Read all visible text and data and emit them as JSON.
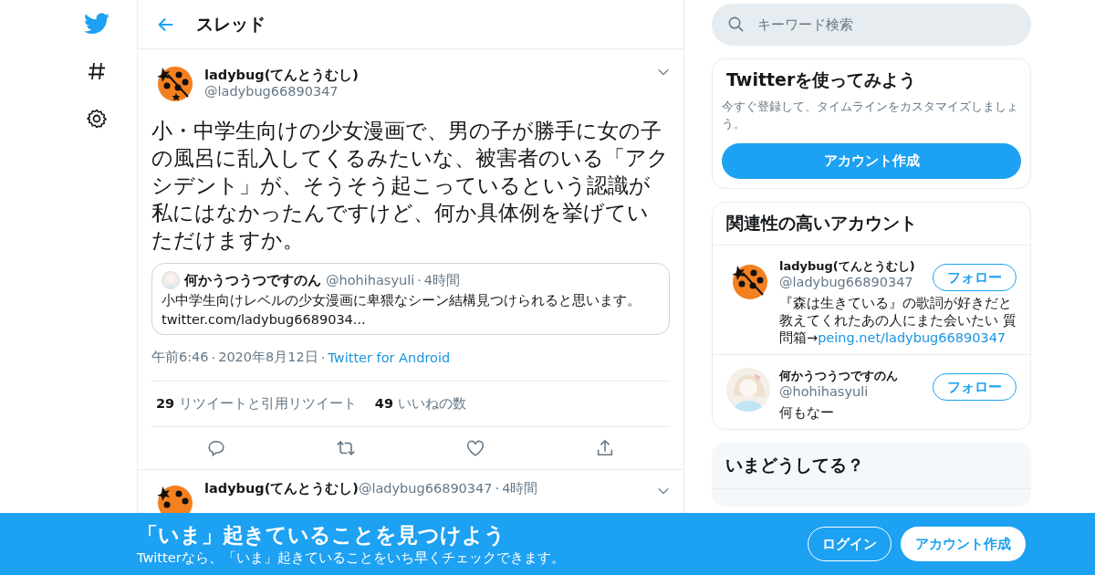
{
  "header": {
    "title": "スレッド"
  },
  "tweet": {
    "name": "ladybug(てんとうむし)",
    "handle": "@ladybug66890347",
    "text": "小・中学生向けの少女漫画で、男の子が勝手に女の子の風呂に乱入してくるみたいな、被害者のいる「アクシデント」が、そうそう起こっているという認識が私にはなかったんですけど、何か具体例を挙げていただけますか。",
    "quote": {
      "name": "何かうつうつですのん",
      "handle": "@hohihasyuli",
      "separator": "·",
      "time": "4時間",
      "text": "小中学生向けレベルの少女漫画に卑猥なシーン結構見つけられると思います。",
      "link": "twitter.com/ladybug6689034..."
    },
    "time": "午前6:46",
    "separators": [
      "·",
      "·"
    ],
    "date": "2020年8月12日",
    "source": "Twitter for Android",
    "stats": [
      {
        "count": "29",
        "label": "リツイートと引用リツイート"
      },
      {
        "count": "49",
        "label": "いいねの数"
      }
    ]
  },
  "reply": {
    "name": "ladybug(てんとうむし)",
    "handle": "@ladybug66890347",
    "separator": "·",
    "time": "4時間"
  },
  "search": {
    "placeholder": "キーワード検索"
  },
  "signup": {
    "title": "Twitterを使ってみよう",
    "text": "今すぐ登録して、タイムラインをカスタマイズしましょう。",
    "button": "アカウント作成"
  },
  "related": {
    "title": "関連性の高いアカウント",
    "accounts": [
      {
        "kind": "ladybug",
        "name": "ladybug(てんとうむし)",
        "handle": "@ladybug66890347",
        "bio": "『森は生きている』の歌詞が好きだと教えてくれたあの人にまた会いたい 質問箱→",
        "link": "peing.net/ladybug66890347",
        "button": "フォロー"
      },
      {
        "kind": "picture",
        "name": "何かうつうつですのん",
        "handle": "@hohihasyuli",
        "bio": "何もなー",
        "button": "フォロー"
      }
    ]
  },
  "trends": {
    "title": "いまどうしてる？"
  },
  "banner": {
    "title": "「いま」起きていることを見つけよう",
    "text": "Twitterなら、「いま」起きていることをいち早くチェックできます。",
    "login": "ログイン",
    "signup": "アカウント作成"
  }
}
